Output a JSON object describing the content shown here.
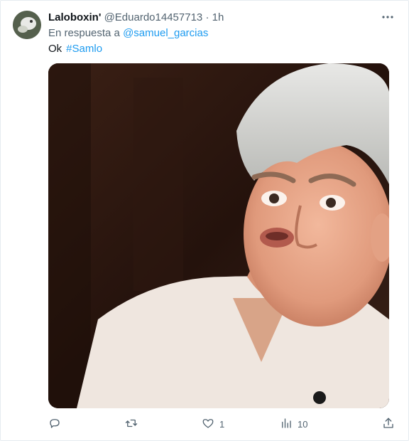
{
  "tweet": {
    "display_name": "Laloboxin'",
    "handle": "@Eduardo14457713",
    "dot": "·",
    "time": "1h",
    "more_icon": "more-icon",
    "reply_prefix": "En respuesta a",
    "reply_to": "@samuel_garcias",
    "text": "Ok",
    "hashtag": "#Samlo"
  },
  "actions": {
    "reply_count": "",
    "retweet_count": "",
    "like_count": "1",
    "views_count": "10"
  },
  "icons": [
    "reply-icon",
    "retweet-icon",
    "like-icon",
    "views-icon",
    "share-icon"
  ],
  "colors": {
    "link": "#1d9bf0",
    "muted": "#536471",
    "text": "#0f1419"
  }
}
